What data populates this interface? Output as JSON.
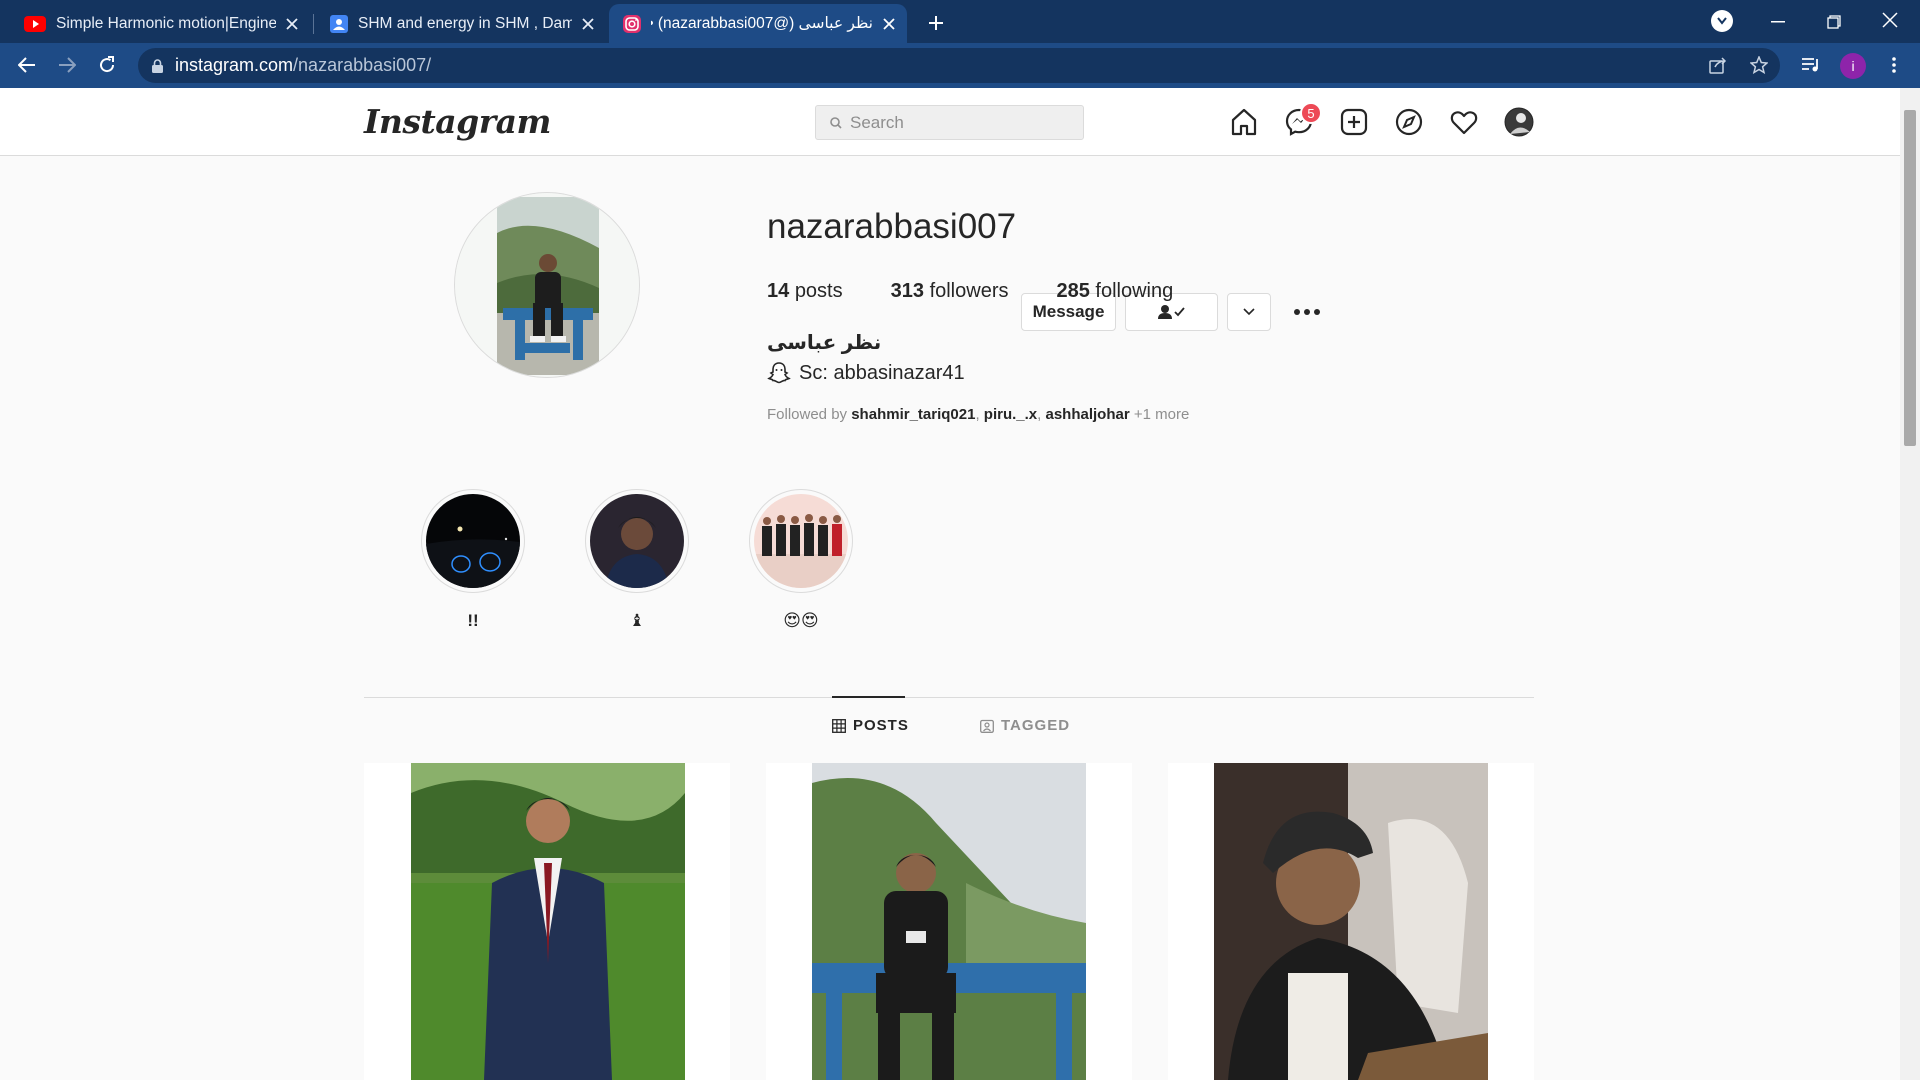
{
  "browser": {
    "tabs": [
      {
        "title": "Simple Harmonic motion|Enginee",
        "icon": "youtube-icon"
      },
      {
        "title": "SHM and energy in SHM , Dampi",
        "icon": "classroom-icon"
      },
      {
        "title": "نظر عباسی (@nazarabbasi007) • ",
        "icon": "instagram-icon"
      }
    ],
    "new_tab_label": "+",
    "url_host": "instagram.com",
    "url_path": "/nazarabbasi007/",
    "profile_initial": "i"
  },
  "instagram": {
    "logo": "Instagram",
    "search_placeholder": "Search",
    "messenger_badge": "5",
    "accent_badge": "#ed4956",
    "profile": {
      "username": "nazarabbasi007",
      "message_button": "Message",
      "stats": {
        "posts": "14",
        "posts_label": "posts",
        "followers": "313",
        "followers_label": "followers",
        "following": "285",
        "following_label": "following"
      },
      "full_name": "نظر عباسی",
      "bio": "Sc: abbasinazar41",
      "bio_icon": "snapchat-ghost-icon",
      "followed_by_prefix": "Followed by",
      "followed_by_1": "shahmir_tariq021",
      "followed_by_2": "piru._.x",
      "followed_by_3": "ashhaljohar",
      "followed_by_more": "+1 more"
    },
    "highlights": [
      {
        "label": "!!"
      },
      {
        "label": "♝"
      },
      {
        "label": "😍😍"
      }
    ],
    "tabs": {
      "posts": "POSTS",
      "tagged": "TAGGED"
    }
  }
}
